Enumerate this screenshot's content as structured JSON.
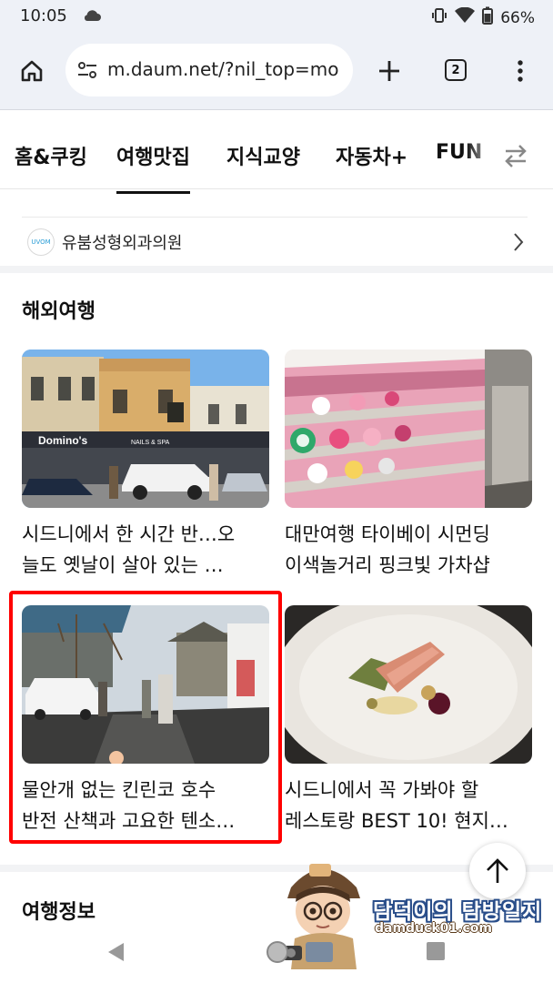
{
  "status": {
    "time": "10:05",
    "battery": "66%"
  },
  "browser": {
    "url": "m.daum.net/?nil_top=mo",
    "tab_count": "2"
  },
  "categories": [
    {
      "label": "홈&쿠킹",
      "active": false
    },
    {
      "label": "여행맛집",
      "active": true
    },
    {
      "label": "지식교양",
      "active": false
    },
    {
      "label": "자동차+",
      "active": false
    },
    {
      "label": "FUN",
      "active": false
    }
  ],
  "sponsor": {
    "logo_text": "UVOM",
    "name": "유붐성형외과의원"
  },
  "sections": {
    "overseas": {
      "title": "해외여행"
    },
    "info": {
      "title": "여행정보"
    }
  },
  "cards": [
    {
      "line1": "시드니에서 한 시간 반…오",
      "line2": "늘도 옛날이 살아 있는 …"
    },
    {
      "line1": "대만여행 타이베이 시먼딩",
      "line2": "이색놀거리 핑크빛 가차샵"
    },
    {
      "line1": "물안개 없는 킨린코 호수",
      "line2": "반전 산책과 고요한 텐소…"
    },
    {
      "line1": "시드니에서 꼭 가봐야 할",
      "line2": "레스토랑 BEST 10! 현지…"
    }
  ],
  "thumb_text": {
    "dominos": "Domino's",
    "nails": "NAILS & SPA"
  },
  "watermark": {
    "title": "담덕이의 탐방일지",
    "url": "damduck01.com"
  },
  "colors": {
    "highlight": "#ff0000",
    "toolbar_bg": "#eef1f7",
    "accent_text": "#111111"
  }
}
